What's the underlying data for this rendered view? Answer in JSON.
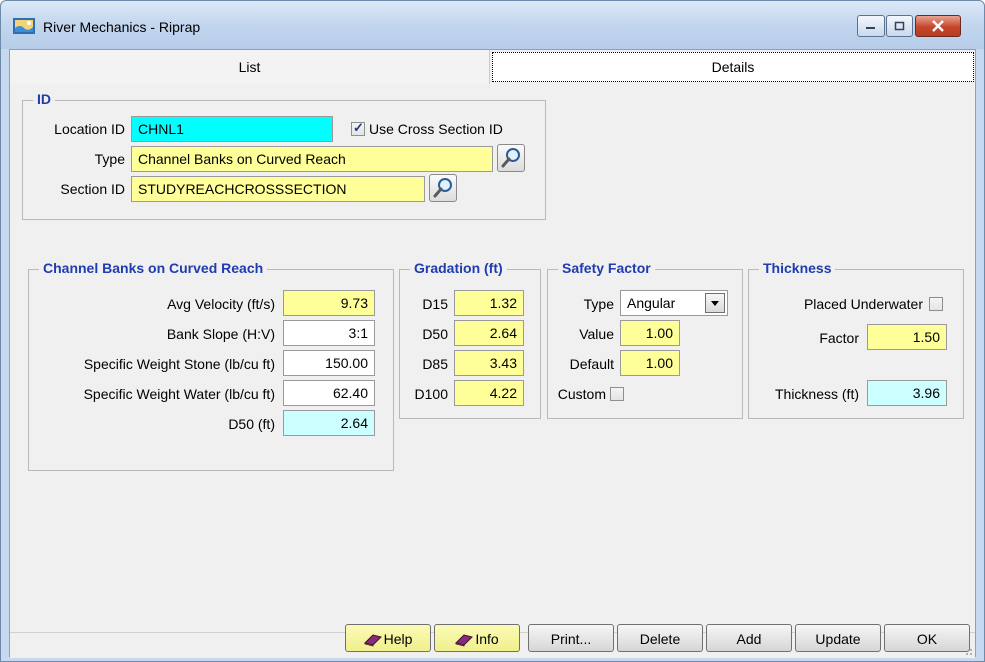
{
  "window": {
    "title": "River Mechanics - Riprap",
    "controls": {
      "minimize": "minimize",
      "maximize": "maximize",
      "close": "close"
    }
  },
  "tabs": [
    {
      "label": "List",
      "active": false
    },
    {
      "label": "Details",
      "active": true
    }
  ],
  "id_group": {
    "title": "ID",
    "location_id_label": "Location ID",
    "location_id_value": "CHNL1",
    "use_cross_section_label": "Use Cross Section ID",
    "use_cross_section_checked": true,
    "type_label": "Type",
    "type_value": "Channel Banks on Curved Reach",
    "section_id_label": "Section ID",
    "section_id_value": "STUDYREACHCROSSSECTION"
  },
  "channel_group": {
    "title": "Channel Banks on Curved Reach",
    "rows": [
      {
        "label": "Avg Velocity (ft/s)",
        "value": "9.73"
      },
      {
        "label": "Bank Slope (H:V)",
        "value": "3:1"
      },
      {
        "label": "Specific Weight Stone (lb/cu ft)",
        "value": "150.00"
      },
      {
        "label": "Specific Weight Water (lb/cu ft)",
        "value": "62.40"
      },
      {
        "label": "D50 (ft)",
        "value": "2.64"
      }
    ]
  },
  "gradation_group": {
    "title": "Gradation (ft)",
    "rows": [
      {
        "label": "D15",
        "value": "1.32"
      },
      {
        "label": "D50",
        "value": "2.64"
      },
      {
        "label": "D85",
        "value": "3.43"
      },
      {
        "label": "D100",
        "value": "4.22"
      }
    ]
  },
  "safety_group": {
    "title": "Safety Factor",
    "type_label": "Type",
    "type_value": "Angular",
    "value_label": "Value",
    "value_value": "1.00",
    "default_label": "Default",
    "default_value": "1.00",
    "custom_label": "Custom",
    "custom_checked": false
  },
  "thickness_group": {
    "title": "Thickness",
    "placed_underwater_label": "Placed Underwater",
    "placed_underwater_checked": false,
    "factor_label": "Factor",
    "factor_value": "1.50",
    "thickness_label": "Thickness (ft)",
    "thickness_value": "3.96"
  },
  "buttons": {
    "help": "Help",
    "info": "Info",
    "print": "Print...",
    "delete": "Delete",
    "add": "Add",
    "update": "Update",
    "ok": "OK"
  },
  "colors": {
    "required_field": "#ffff99",
    "key_field": "#00ffff",
    "computed_field": "#ccffff",
    "group_title": "#1f3cb0"
  },
  "icons": {
    "app": "river-mechanics-app-icon",
    "lookup": "magnifier-icon",
    "help": "book-icon",
    "info": "book-icon"
  }
}
